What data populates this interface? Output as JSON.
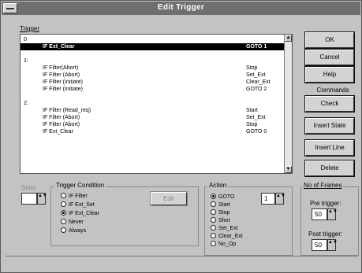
{
  "window": {
    "title": "Edit Trigger"
  },
  "trigger_list": {
    "label": "Trigger",
    "rows": [
      {
        "c1": "0",
        "c2": "",
        "c3": ""
      },
      {
        "c1": "",
        "c2": "IF Ext_Clear",
        "c3": "GOTO 1"
      },
      {
        "c1": "",
        "c2": "",
        "c3": ""
      },
      {
        "c1": "1:",
        "c2": "",
        "c3": ""
      },
      {
        "c1": "",
        "c2": "IF Filter(Abort)",
        "c3": "Stop"
      },
      {
        "c1": "",
        "c2": "IF Filter (Abort)",
        "c3": "Set_Ext"
      },
      {
        "c1": "",
        "c2": "IF Filter (Initiate)",
        "c3": "Clear_Ext"
      },
      {
        "c1": "",
        "c2": "IF Filter (Initiate)",
        "c3": "GOTO 2"
      },
      {
        "c1": "",
        "c2": "",
        "c3": ""
      },
      {
        "c1": "2:",
        "c2": "",
        "c3": ""
      },
      {
        "c1": "",
        "c2": "IF Filter (Read_req)",
        "c3": "Start"
      },
      {
        "c1": "",
        "c2": "IF Filter (Abort)",
        "c3": "Set_Ext"
      },
      {
        "c1": "",
        "c2": "IF Filter (Abort)",
        "c3": "Stop"
      },
      {
        "c1": "",
        "c2": "IF Ext_Clear",
        "c3": "GOTO 0"
      }
    ]
  },
  "buttons": {
    "ok": "OK",
    "cancel": "Cancel",
    "help": "Help",
    "commands_label": "Commands",
    "check": "Check",
    "insert_state": "Insert State",
    "insert_line": "Insert Line",
    "delete": "Delete",
    "edit": "Edit"
  },
  "state": {
    "label": "State",
    "value": ""
  },
  "trigger_condition": {
    "label": "Trigger Condition",
    "options": [
      "IF Filter",
      "IF Ext_Set",
      "IF Ext_Clear",
      "Never",
      "Always"
    ],
    "selected_index": 2
  },
  "action": {
    "label": "Action",
    "options": [
      "GOTO",
      "Start",
      "Stop",
      "Shot",
      "Set_Ext",
      "Clear_Ext",
      "No_Op"
    ],
    "selected_index": 0,
    "goto_value": "1"
  },
  "frames": {
    "label": "No of Frames",
    "pre_label": "Pre trigger:",
    "pre_value": "50",
    "post_label": "Post trigger:",
    "post_value": "50"
  },
  "icons": {
    "up": "▲",
    "down": "▼",
    "spin": "▲▼"
  }
}
